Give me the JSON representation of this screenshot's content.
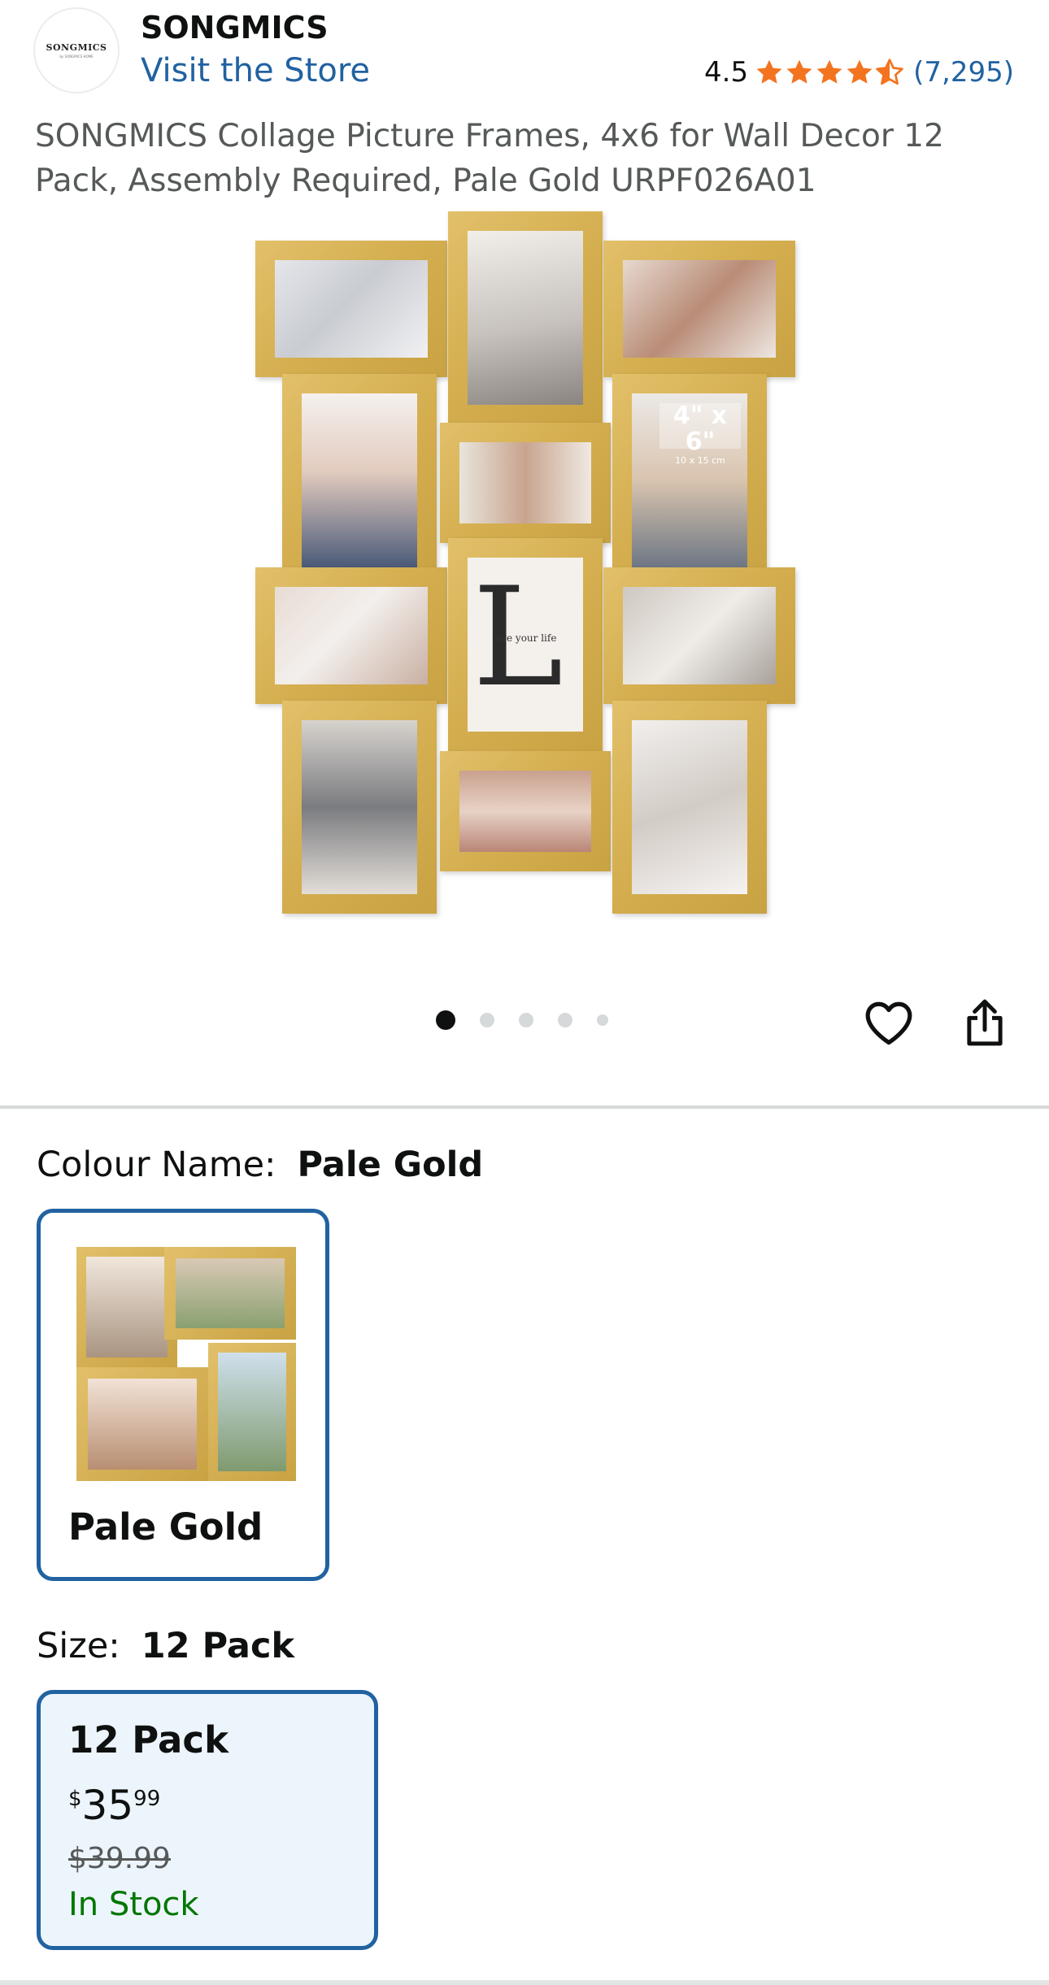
{
  "brand": {
    "logo_text": "SONGMICS",
    "logo_subtext": "by SONGMICS HOME",
    "name": "SONGMICS",
    "store_link": "Visit the Store"
  },
  "rating": {
    "value": "4.5",
    "stars": 4.5,
    "count": "(7,295)",
    "star_color": "#f3731f"
  },
  "product_title": "SONGMICS Collage Picture Frames, 4x6 for Wall Decor 12 Pack, Assembly Required, Pale Gold URPF026A01",
  "hero_image": {
    "badge_size": "4\" x 6\"",
    "badge_metric": "10 x 15 cm",
    "sign_letter": "L",
    "sign_text": "ove your life"
  },
  "carousel": {
    "total": 5,
    "active": 1
  },
  "actions": {
    "wishlist_icon": "heart-icon",
    "share_icon": "share-icon"
  },
  "colour": {
    "label": "Colour Name:",
    "selected": "Pale Gold",
    "options": [
      "Pale Gold"
    ]
  },
  "size": {
    "label": "Size:",
    "selected": "12 Pack",
    "options": [
      {
        "name": "12 Pack",
        "currency": "$",
        "price_whole": "35",
        "price_fraction": "99",
        "list_price": "$39.99",
        "availability": "In Stock"
      }
    ]
  },
  "colors": {
    "link": "#2162a1",
    "selected_border": "#2162a1",
    "selected_bg": "#edf5fc",
    "in_stock": "#007600",
    "frame_gold": "#d4ae4f"
  }
}
